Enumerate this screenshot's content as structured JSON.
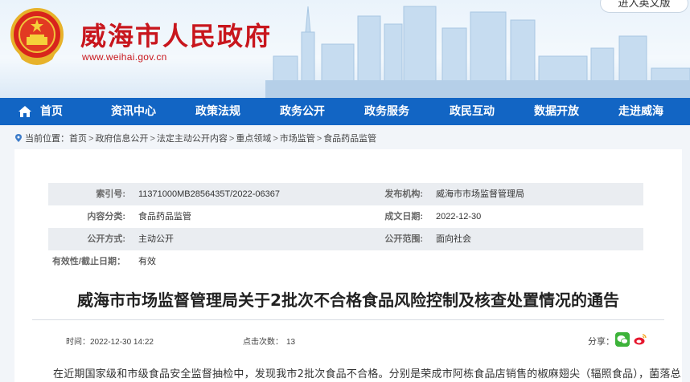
{
  "header": {
    "site_title": "威海市人民政府",
    "site_url": "www.weihai.gov.cn",
    "lang_button": "进入英文版",
    "brand_red": "#c8161d"
  },
  "nav": {
    "color": "#1265c4",
    "items": [
      {
        "label": "首页",
        "icon": "home-icon"
      },
      {
        "label": "资讯中心"
      },
      {
        "label": "政策法规"
      },
      {
        "label": "政务公开"
      },
      {
        "label": "政务服务"
      },
      {
        "label": "政民互动"
      },
      {
        "label": "数据开放"
      },
      {
        "label": "走进威海"
      }
    ]
  },
  "breadcrumb": {
    "prefix": "当前位置：",
    "items": [
      "首页",
      "政府信息公开",
      "法定主动公开内容",
      "重点领域",
      "市场监管",
      "食品药品监管"
    ],
    "separator": ">"
  },
  "meta": {
    "index_label": "索引号:",
    "index_value": "11371000MB2856435T/2022-06367",
    "publisher_label": "发布机构:",
    "publisher_value": "威海市市场监督管理局",
    "category_label": "内容分类:",
    "category_value": "食品药品监管",
    "date_label": "成文日期:",
    "date_value": "2022-12-30",
    "disclosure_label": "公开方式:",
    "disclosure_value": "主动公开",
    "scope_label": "公开范围:",
    "scope_value": "面向社会",
    "validity_label": "有效性/截止日期：",
    "validity_value": "有效"
  },
  "article": {
    "title": "威海市市场监督管理局关于2批次不合格食品风险控制及核查处置情况的通告",
    "time_label": "时间：",
    "time_value": "2022-12-30 14:22",
    "clicks_label": "点击次数：",
    "clicks_value": "13",
    "share_label": "分享：",
    "share_icons": [
      "wechat-icon",
      "weibo-icon"
    ],
    "body_first_line": "在近期国家级和市级食品安全监督抽检中，发现我市2批次食品不合格。分别是荣成市阿栋食品店销售的椒麻翅尖（辐照食品），菌落总"
  }
}
